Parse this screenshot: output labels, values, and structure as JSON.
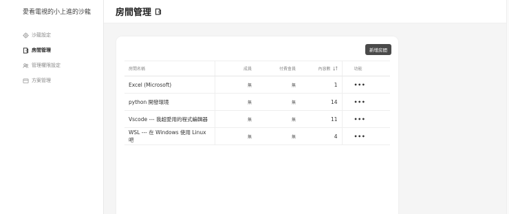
{
  "sidebar": {
    "title": "愛看電視的小上進的沙龍",
    "items": [
      {
        "label": "沙龍設定",
        "icon": "gear-icon",
        "active": false
      },
      {
        "label": "房間管理",
        "icon": "door-icon",
        "active": true
      },
      {
        "label": "管理權限設定",
        "icon": "users-icon",
        "active": false
      },
      {
        "label": "方案管理",
        "icon": "card-icon",
        "active": false
      }
    ]
  },
  "header": {
    "title": "房間管理"
  },
  "toolbar": {
    "add_label": "新增房間"
  },
  "table": {
    "columns": {
      "name": "房間名稱",
      "member": "成員",
      "paid": "付費會員",
      "count": "內容數",
      "func": "功能"
    },
    "rows": [
      {
        "name": "Excel (Microsoft)",
        "member": "無",
        "paid": "無",
        "count": "1",
        "func": "•••"
      },
      {
        "name": "python 開發環境",
        "member": "無",
        "paid": "無",
        "count": "14",
        "func": "•••"
      },
      {
        "name": "Vscode --- 我超愛用的程式編輯器",
        "member": "無",
        "paid": "無",
        "count": "11",
        "func": "•••"
      },
      {
        "name": "WSL --- 在 Windows 使用 Linux 吧",
        "member": "無",
        "paid": "無",
        "count": "4",
        "func": "•••"
      }
    ]
  }
}
